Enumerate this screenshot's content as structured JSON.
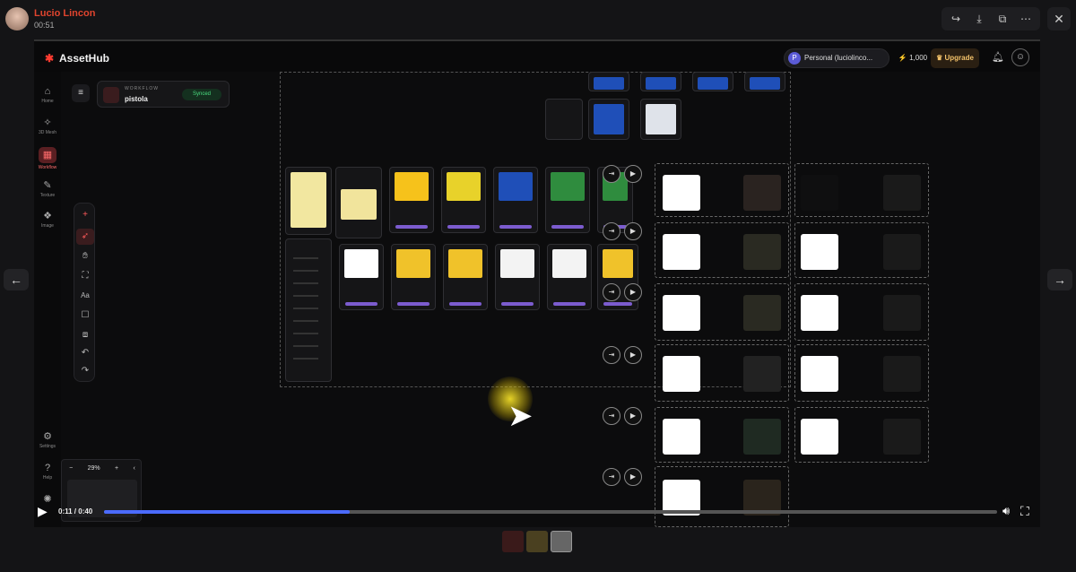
{
  "message": {
    "author": "Lucio Lincon",
    "time": "00:51"
  },
  "viewer": {
    "actions": [
      "share-icon",
      "download-icon",
      "open-external-icon",
      "more-icon"
    ],
    "close_icon": "close-icon"
  },
  "app": {
    "logo": "AssetHub",
    "workspace": "Personal (luciolinco...",
    "workspace_initial": "P",
    "credits": "1,000",
    "upgrade": "Upgrade",
    "sidebar": [
      {
        "label": "Home",
        "icon": "home-icon"
      },
      {
        "label": "3D Mesh",
        "icon": "mesh-icon"
      },
      {
        "label": "Workflow",
        "icon": "workflow-icon",
        "active": true
      },
      {
        "label": "Texture",
        "icon": "texture-icon"
      },
      {
        "label": "Image",
        "icon": "image-icon"
      },
      {
        "label": "Settings",
        "icon": "gear-icon"
      },
      {
        "label": "Help",
        "icon": "help-icon"
      }
    ],
    "workflow": {
      "label": "WORKFLOW",
      "name": "pistola",
      "status": "Synced"
    },
    "zoom": "29%"
  },
  "player": {
    "timecode": "0:11 / 0:40",
    "progress": 0.275
  },
  "colors": {
    "accent": "#ff3b30",
    "progress": "#4b6bff",
    "node_bar": "#7c5ccf"
  }
}
